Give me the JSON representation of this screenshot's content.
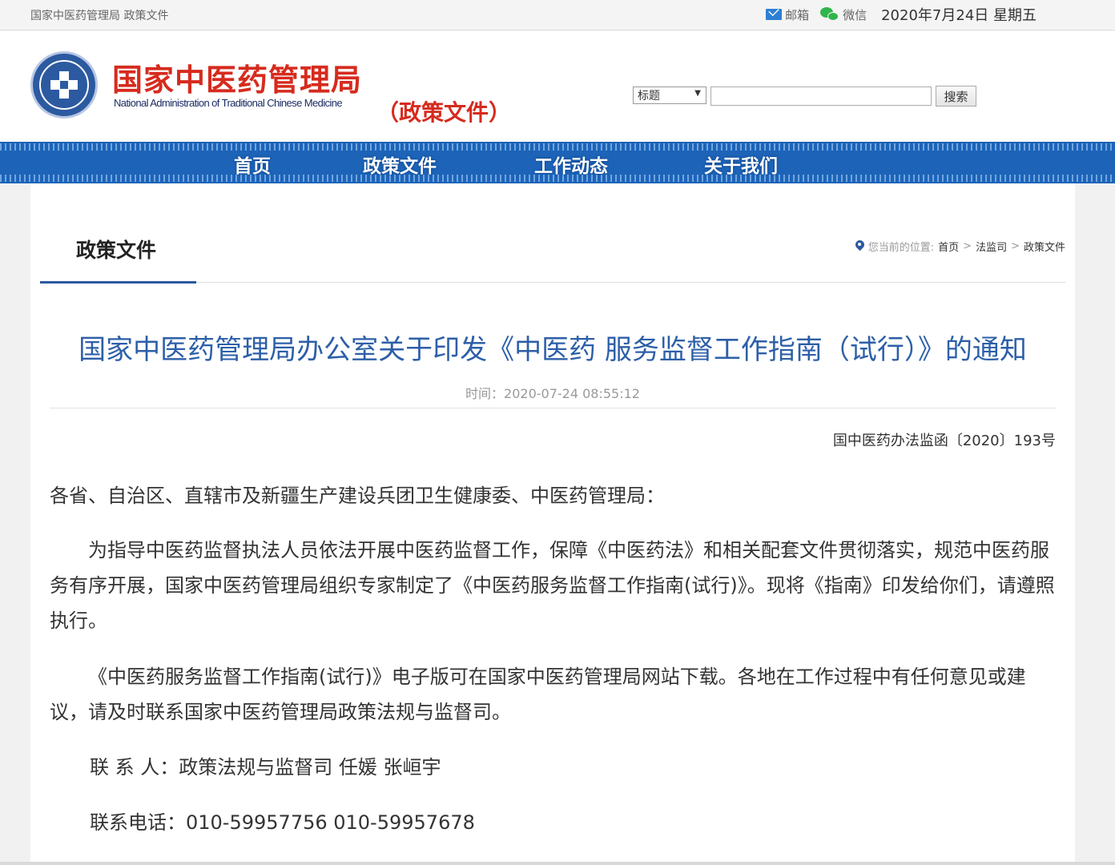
{
  "topbar": {
    "breadcrumb": "国家中医药管理局 政策文件",
    "mail_label": "邮箱",
    "wechat_label": "微信",
    "date": "2020年7月24日 星期五"
  },
  "header": {
    "org_name_cn": "国家中医药管理局",
    "org_name_en": "National Administration of Traditional Chinese Medicine",
    "section_tag": "（政策文件）",
    "search": {
      "select_value": "标题",
      "input_value": "",
      "button_label": "搜索"
    }
  },
  "nav": {
    "items": [
      {
        "label": "首页"
      },
      {
        "label": "政策文件"
      },
      {
        "label": "工作动态"
      },
      {
        "label": "关于我们"
      }
    ]
  },
  "panel": {
    "title": "政策文件",
    "location": {
      "label": "您当前的位置:",
      "crumbs": [
        "首页",
        "法监司",
        "政策文件"
      ],
      "separator": ">"
    }
  },
  "article": {
    "title": "国家中医药管理局办公室关于印发《中医药 服务监督工作指南（试行）》的通知",
    "time": "时间：2020-07-24 08:55:12",
    "doc_number": "国中医药办法监函〔2020〕193号",
    "salutation": "各省、自治区、直辖市及新疆生产建设兵团卫生健康委、中医药管理局：",
    "para1": "为指导中医药监督执法人员依法开展中医药监督工作，保障《中医药法》和相关配套文件贯彻落实，规范中医药服务有序开展，国家中医药管理局组织专家制定了《中医药服务监督工作指南(试行)》。现将《指南》印发给你们，请遵照执行。",
    "para2": "《中医药服务监督工作指南(试行)》电子版可在国家中医药管理局网站下载。各地在工作过程中有任何意见或建议，请及时联系国家中医药管理局政策法规与监督司。",
    "contact": "联 系 人：政策法规与监督司 任媛 张峘宇",
    "phone": "联系电话：010-59957756 010-59957678"
  }
}
